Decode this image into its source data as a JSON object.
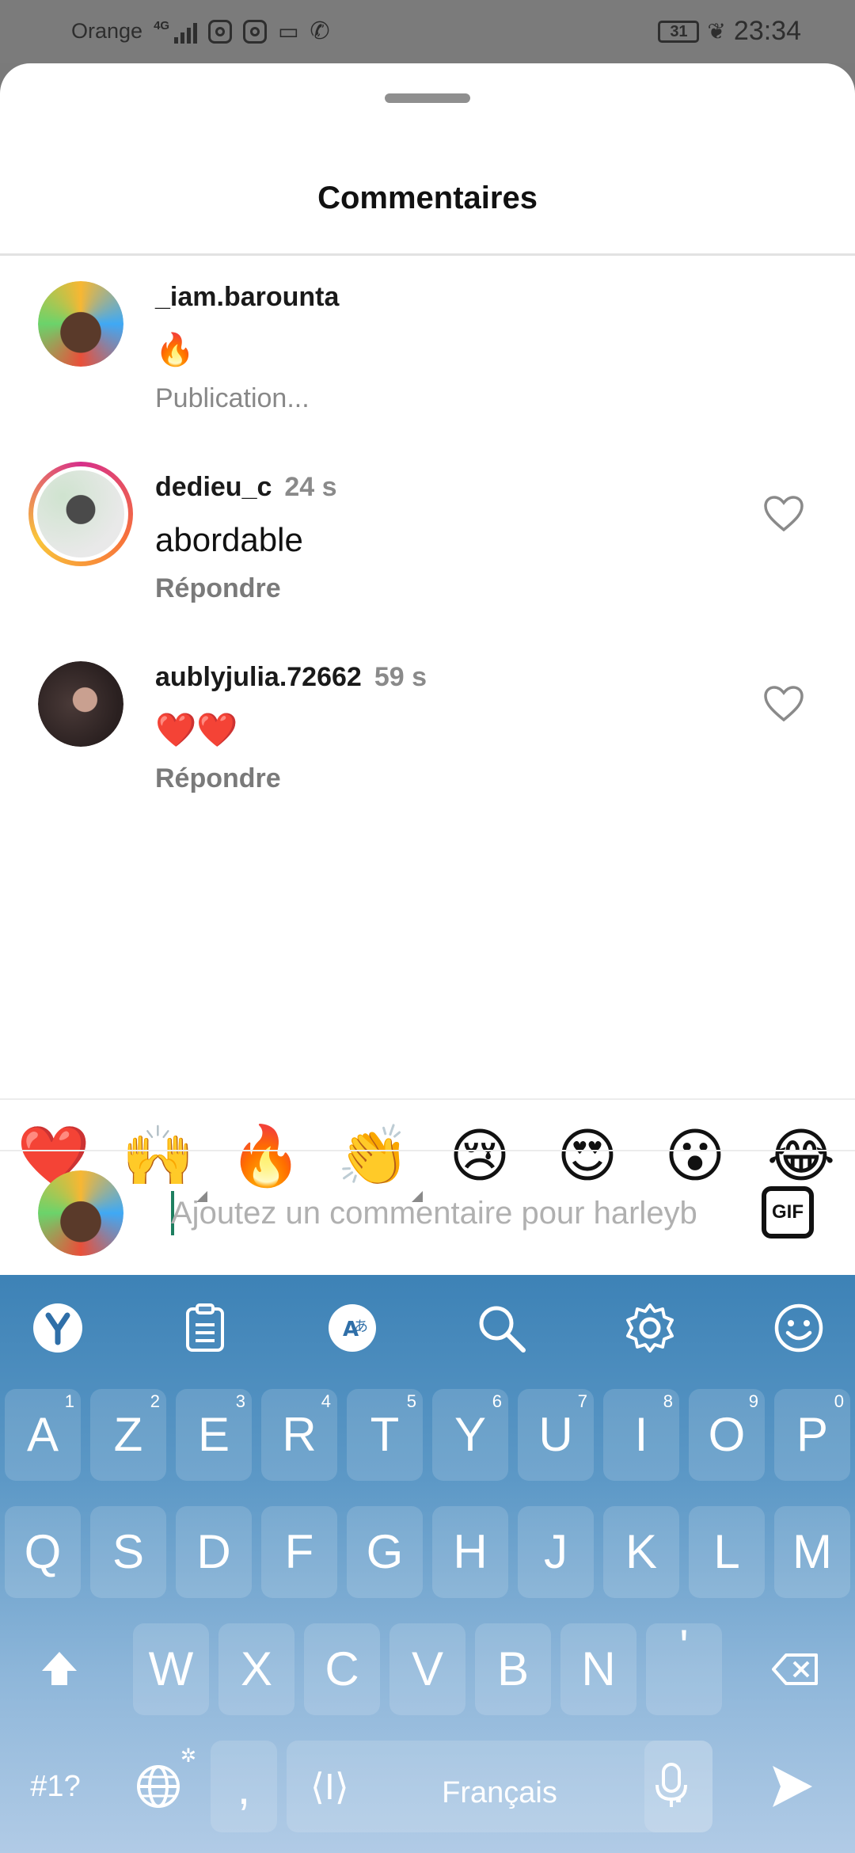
{
  "status_bar": {
    "carrier": "Orange",
    "network": "4G",
    "battery": "31",
    "time": "23:34"
  },
  "sheet": {
    "title": "Commentaires"
  },
  "comments": [
    {
      "username": "_iam.barounta",
      "time": "",
      "text": "🔥",
      "sub": "Publication...",
      "avatar_colors": [
        "#f7b733",
        "#3fa9f5",
        "#e8503a"
      ],
      "has_heart": false
    },
    {
      "username": "dedieu_c",
      "time": "24 s",
      "text": "abordable",
      "sub": "Répondre",
      "avatar_colors": [
        "#cfe3cf",
        "#6e8b6e",
        "#e9e9e9"
      ],
      "has_heart": true
    },
    {
      "username": "aublyjulia.72662",
      "time": "59 s",
      "text": "❤️❤️",
      "sub": "Répondre",
      "avatar_colors": [
        "#4a3a38",
        "#a98574",
        "#2a2020"
      ],
      "has_heart": true
    }
  ],
  "emoji_bar": [
    "❤️",
    "🙌",
    "🔥",
    "👏",
    "😢",
    "😍",
    "😮",
    "😂"
  ],
  "composer": {
    "placeholder": "Ajoutez un commentaire pour harleyb",
    "gif_label": "GIF"
  },
  "keyboard": {
    "tools": [
      "y-logo-icon",
      "clipboard-icon",
      "translate-icon",
      "search-icon",
      "settings-icon",
      "emoji-icon"
    ],
    "row1": [
      {
        "k": "A",
        "n": "1"
      },
      {
        "k": "Z",
        "n": "2"
      },
      {
        "k": "E",
        "n": "3"
      },
      {
        "k": "R",
        "n": "4"
      },
      {
        "k": "T",
        "n": "5"
      },
      {
        "k": "Y",
        "n": "6"
      },
      {
        "k": "U",
        "n": "7"
      },
      {
        "k": "I",
        "n": "8"
      },
      {
        "k": "O",
        "n": "9"
      },
      {
        "k": "P",
        "n": "0"
      }
    ],
    "row2": [
      "Q",
      "S",
      "D",
      "F",
      "G",
      "H",
      "J",
      "K",
      "L",
      "M"
    ],
    "row3": [
      "W",
      "X",
      "C",
      "V",
      "B",
      "N",
      "'"
    ],
    "row4": {
      "symbols": "#1?",
      "comma": ",",
      "space": "Français",
      "period": "."
    }
  }
}
